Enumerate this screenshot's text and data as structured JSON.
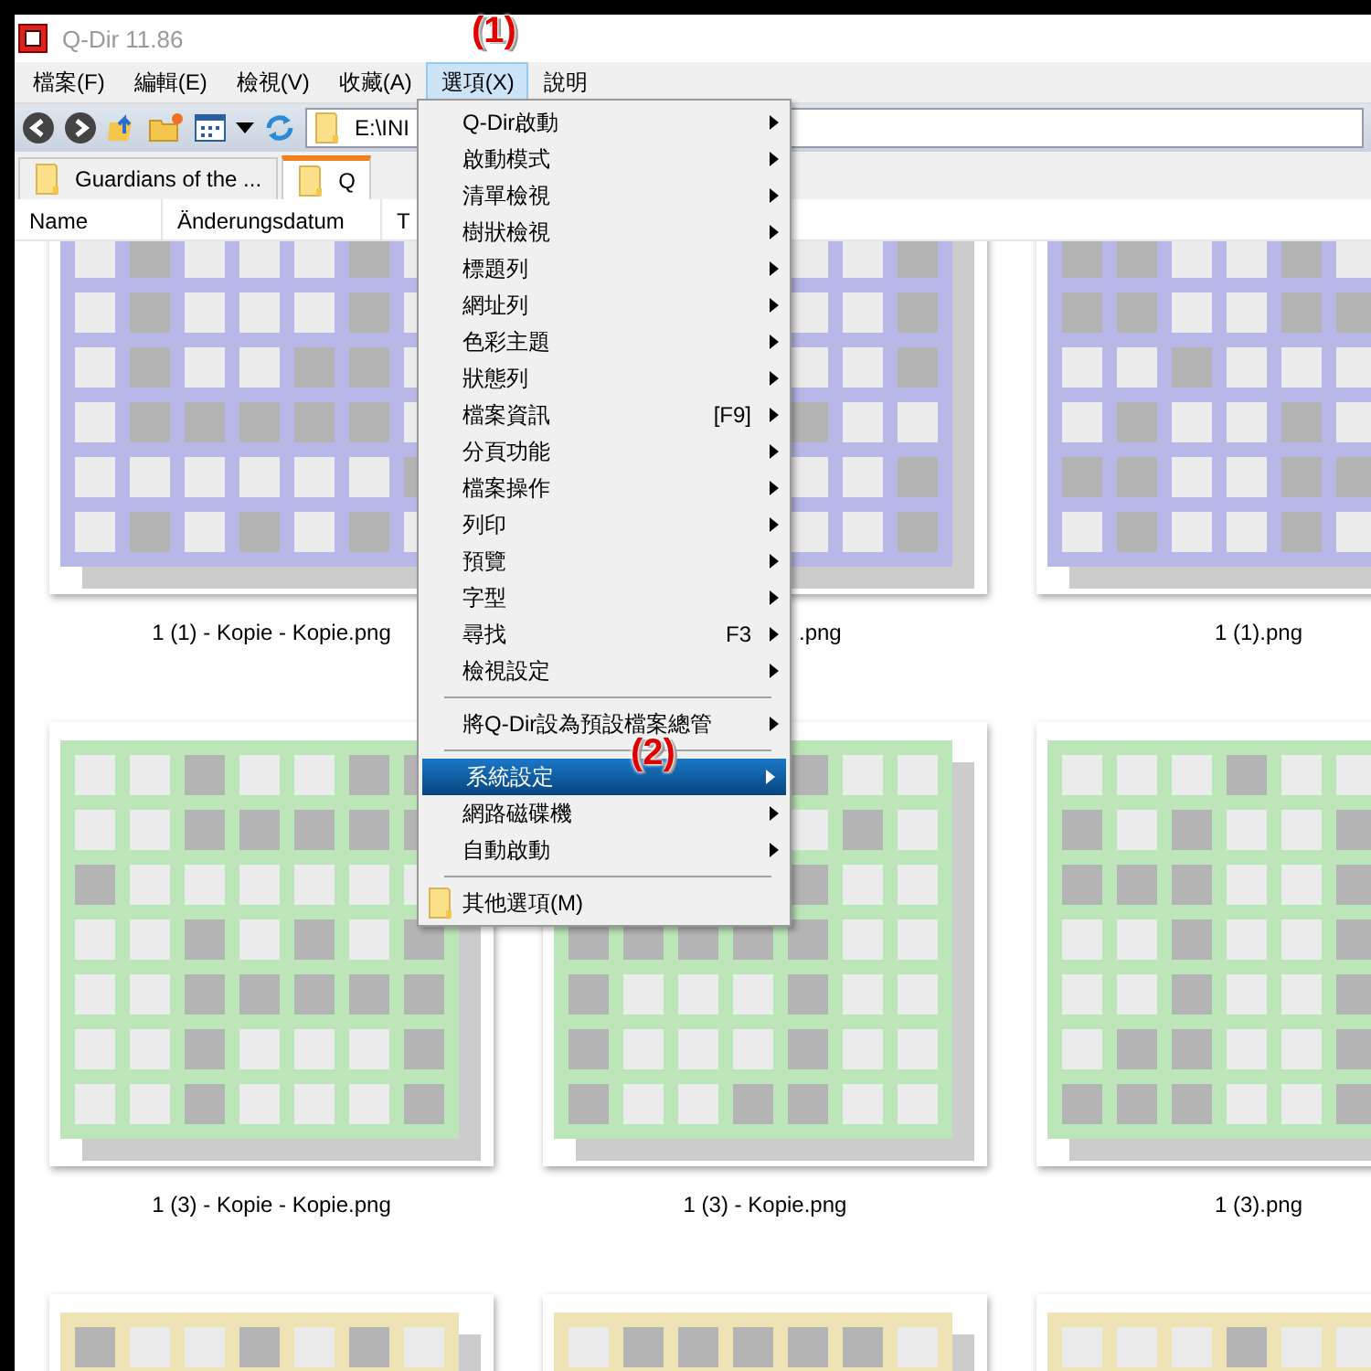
{
  "window": {
    "title": "Q-Dir 11.86"
  },
  "menubar": [
    {
      "label": "檔案(F)",
      "selected": false
    },
    {
      "label": "編輯(E)",
      "selected": false
    },
    {
      "label": "檢視(V)",
      "selected": false
    },
    {
      "label": "收藏(A)",
      "selected": false
    },
    {
      "label": "選項(X)",
      "selected": true
    },
    {
      "label": "說明",
      "selected": false
    }
  ],
  "address": {
    "value": "E:\\INI"
  },
  "tabs": [
    {
      "label": "Guardians of the ...",
      "selected": false
    },
    {
      "label": "Q",
      "selected": true
    }
  ],
  "columns": [
    "Name",
    "Änderungsdatum",
    "T"
  ],
  "thumbnails": [
    {
      "label": "1 (1) - Kopie - Kopie.png",
      "color": "#b8b8e8",
      "covered": false
    },
    {
      "label": ".png",
      "color": "#b8b8e8",
      "covered": true
    },
    {
      "label": "1 (1).png",
      "color": "#b8b8e8",
      "covered": false
    },
    {
      "label": "1 (3) - Kopie - Kopie.png",
      "color": "#bde6b8",
      "covered": false
    },
    {
      "label": "1 (3) - Kopie.png",
      "color": "#bde6b8",
      "covered": false
    },
    {
      "label": "1 (3).png",
      "color": "#bde6b8",
      "covered": false
    },
    {
      "color": "#ede3b4"
    },
    {
      "color": "#ede3b4"
    },
    {
      "color": "#ede3b4"
    }
  ],
  "options_menu": [
    {
      "kind": "item",
      "label": "Q-Dir啟動",
      "selected": false
    },
    {
      "kind": "item",
      "label": "啟動模式",
      "selected": false
    },
    {
      "kind": "item",
      "label": "清單檢視",
      "selected": false
    },
    {
      "kind": "item",
      "label": "樹狀檢視",
      "selected": false
    },
    {
      "kind": "item",
      "label": "標題列",
      "selected": false
    },
    {
      "kind": "item",
      "label": "網址列",
      "selected": false
    },
    {
      "kind": "item",
      "label": "色彩主題",
      "selected": false
    },
    {
      "kind": "item",
      "label": "狀態列",
      "selected": false
    },
    {
      "kind": "item",
      "label": "檔案資訊",
      "shortcut": "[F9]",
      "selected": false
    },
    {
      "kind": "item",
      "label": "分頁功能",
      "selected": false
    },
    {
      "kind": "item",
      "label": "檔案操作",
      "selected": false
    },
    {
      "kind": "item",
      "label": "列印",
      "selected": false
    },
    {
      "kind": "item",
      "label": "預覽",
      "selected": false
    },
    {
      "kind": "item",
      "label": "字型",
      "selected": false
    },
    {
      "kind": "item",
      "label": "尋找",
      "shortcut": "F3",
      "selected": false
    },
    {
      "kind": "item",
      "label": "檢視設定",
      "selected": false
    },
    {
      "kind": "separator"
    },
    {
      "kind": "item",
      "label": "將Q-Dir設為預設檔案總管",
      "selected": false
    },
    {
      "kind": "separator"
    },
    {
      "kind": "item",
      "label": "系統設定",
      "selected": true
    },
    {
      "kind": "item",
      "label": "網路磁碟機",
      "selected": false
    },
    {
      "kind": "item",
      "label": "自動啟動",
      "selected": false
    },
    {
      "kind": "separator"
    },
    {
      "kind": "folder",
      "label": "其他選項(M)",
      "selected": false
    }
  ],
  "annotations": [
    "(1)",
    "(2)"
  ]
}
